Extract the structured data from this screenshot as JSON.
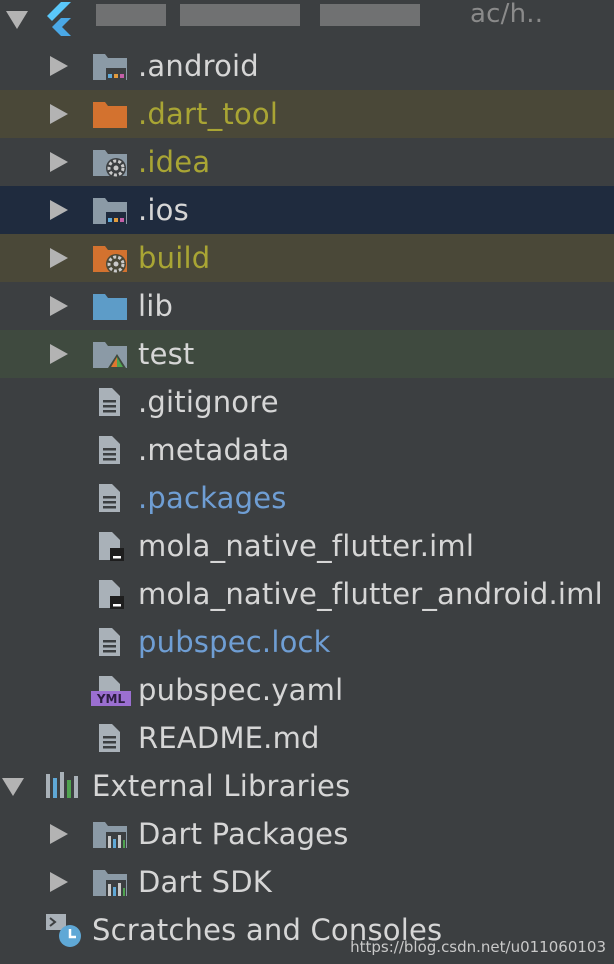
{
  "project": {
    "obscured_title": "ac/h.."
  },
  "items": [
    {
      "label": ".android",
      "kind": "module-folder"
    },
    {
      "label": ".dart_tool",
      "kind": "excluded-folder"
    },
    {
      "label": ".idea",
      "kind": "settings-folder"
    },
    {
      "label": ".ios",
      "kind": "module-folder"
    },
    {
      "label": "build",
      "kind": "excluded-settings-folder"
    },
    {
      "label": "lib",
      "kind": "source-folder"
    },
    {
      "label": "test",
      "kind": "test-folder"
    },
    {
      "label": ".gitignore",
      "kind": "text-file"
    },
    {
      "label": ".metadata",
      "kind": "text-file"
    },
    {
      "label": ".packages",
      "kind": "text-file"
    },
    {
      "label": "mola_native_flutter.iml",
      "kind": "iml-file"
    },
    {
      "label": "mola_native_flutter_android.iml",
      "kind": "iml-file"
    },
    {
      "label": "pubspec.lock",
      "kind": "text-file"
    },
    {
      "label": "pubspec.yaml",
      "kind": "yaml-file"
    },
    {
      "label": "README.md",
      "kind": "text-file"
    }
  ],
  "external": {
    "label": "External Libraries",
    "children": [
      {
        "label": "Dart Packages"
      },
      {
        "label": "Dart SDK"
      }
    ]
  },
  "scratches": {
    "label": "Scratches and Consoles"
  },
  "yml_badge": "YML",
  "watermark": "https://blog.csdn.net/u011060103"
}
